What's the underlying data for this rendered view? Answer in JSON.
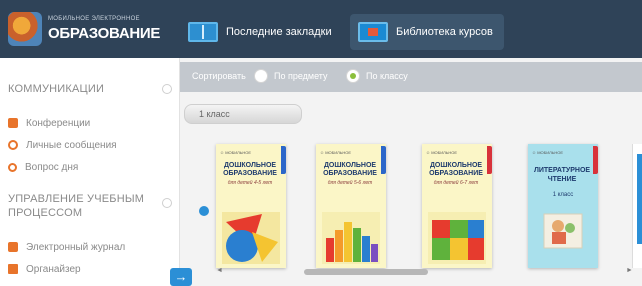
{
  "header": {
    "logo_small": "МОБИЛЬНОЕ ЭЛЕКТРОННОЕ",
    "logo_big": "ОБРАЗОВАНИЕ",
    "tabs": [
      {
        "label": "Последние закладки",
        "icon": "book-icon"
      },
      {
        "label": "Библиотека курсов",
        "icon": "screen-icon",
        "active": true
      }
    ]
  },
  "sidebar": {
    "sections": [
      {
        "title": "КОММУНИКАЦИИ",
        "items": [
          {
            "label": "Конференции",
            "icon": "conference-icon"
          },
          {
            "label": "Личные сообщения",
            "icon": "messages-icon"
          },
          {
            "label": "Вопрос дня",
            "icon": "question-icon"
          }
        ]
      },
      {
        "title": "УПРАВЛЕНИЕ УЧЕБНЫМ ПРОЦЕССОМ",
        "items": [
          {
            "label": "Электронный журнал",
            "icon": "journal-icon"
          },
          {
            "label": "Органайзер",
            "icon": "organizer-icon"
          }
        ]
      }
    ],
    "collapse_icon": "→"
  },
  "filter": {
    "sort_label": "Сортировать",
    "options": [
      {
        "label": "По предмету",
        "checked": false
      },
      {
        "label": "По классу",
        "checked": true
      }
    ]
  },
  "class_tab": "1 класс",
  "cards": [
    {
      "sub": "☺ МОБИЛЬНОЕ",
      "title": "ДОШКОЛЬНОЕ ОБРАЗОВАНИЕ",
      "age": "для детей 4-5 лет",
      "ribbon": "#2b66c9"
    },
    {
      "sub": "☺ МОБИЛЬНОЕ",
      "title": "ДОШКОЛЬНОЕ ОБРАЗОВАНИЕ",
      "age": "для детей 5-6 лет",
      "ribbon": "#2b66c9"
    },
    {
      "sub": "☺ МОБИЛЬНОЕ",
      "title": "ДОШКОЛЬНОЕ ОБРАЗОВАНИЕ",
      "age": "для детей 6-7 лет",
      "ribbon": "#d8323a"
    },
    {
      "sub": "☺ МОБИЛЬНОЕ",
      "title": "ЛИТЕРАТУРНОЕ ЧТЕНИЕ",
      "grade": "1 класс",
      "ribbon": "#d8323a"
    }
  ],
  "scroll": {
    "left": "◄",
    "right": "►"
  }
}
